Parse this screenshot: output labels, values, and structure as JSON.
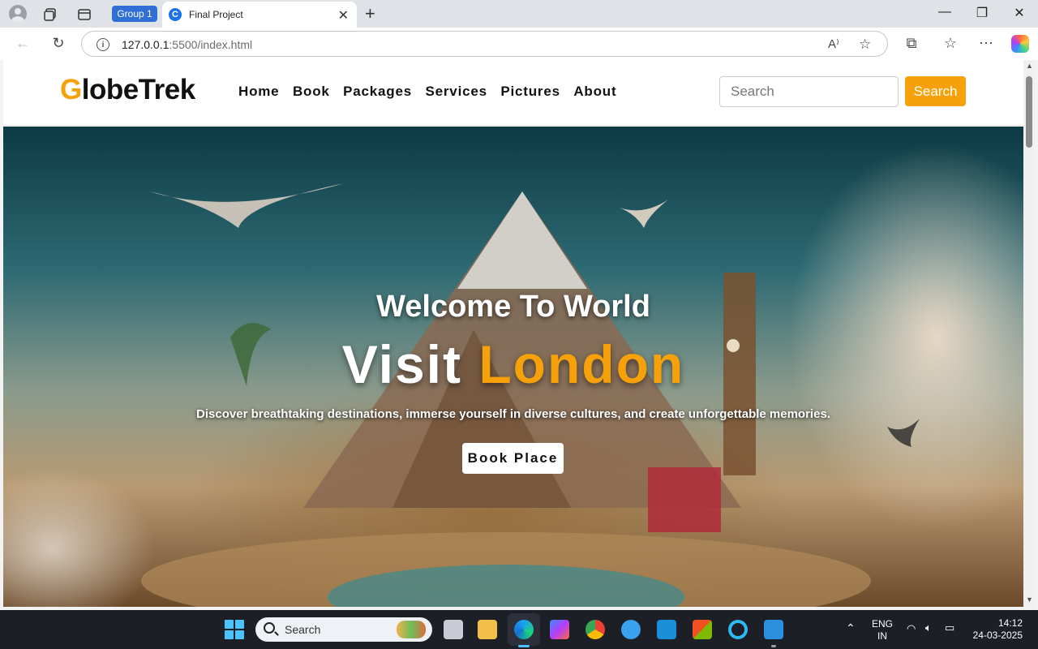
{
  "browser": {
    "tab_group_label": "Group 1",
    "tab_title": "Final Project",
    "tab_favicon_letter": "C",
    "url_host": "127.0.0.1",
    "url_rest": ":5500/index.html"
  },
  "site": {
    "logo_first": "G",
    "logo_rest": "lobeTrek",
    "nav": [
      "Home",
      "Book",
      "Packages",
      "Services",
      "Pictures",
      "About"
    ],
    "search_placeholder": "Search",
    "search_button": "Search"
  },
  "hero": {
    "subtitle": "Welcome To World",
    "title_part1": "Visit ",
    "title_part2": "London",
    "description": "Discover breathtaking destinations, immerse yourself in diverse cultures, and create unforgettable memories.",
    "cta": "Book Place"
  },
  "taskbar": {
    "search_label": "Search",
    "language_line1": "ENG",
    "language_line2": "IN",
    "time": "14:12",
    "date": "24-03-2025"
  },
  "colors": {
    "accent": "#f7a10a",
    "edge_blue": "#1a73e8",
    "taskbar_bg": "#1c1f26"
  }
}
